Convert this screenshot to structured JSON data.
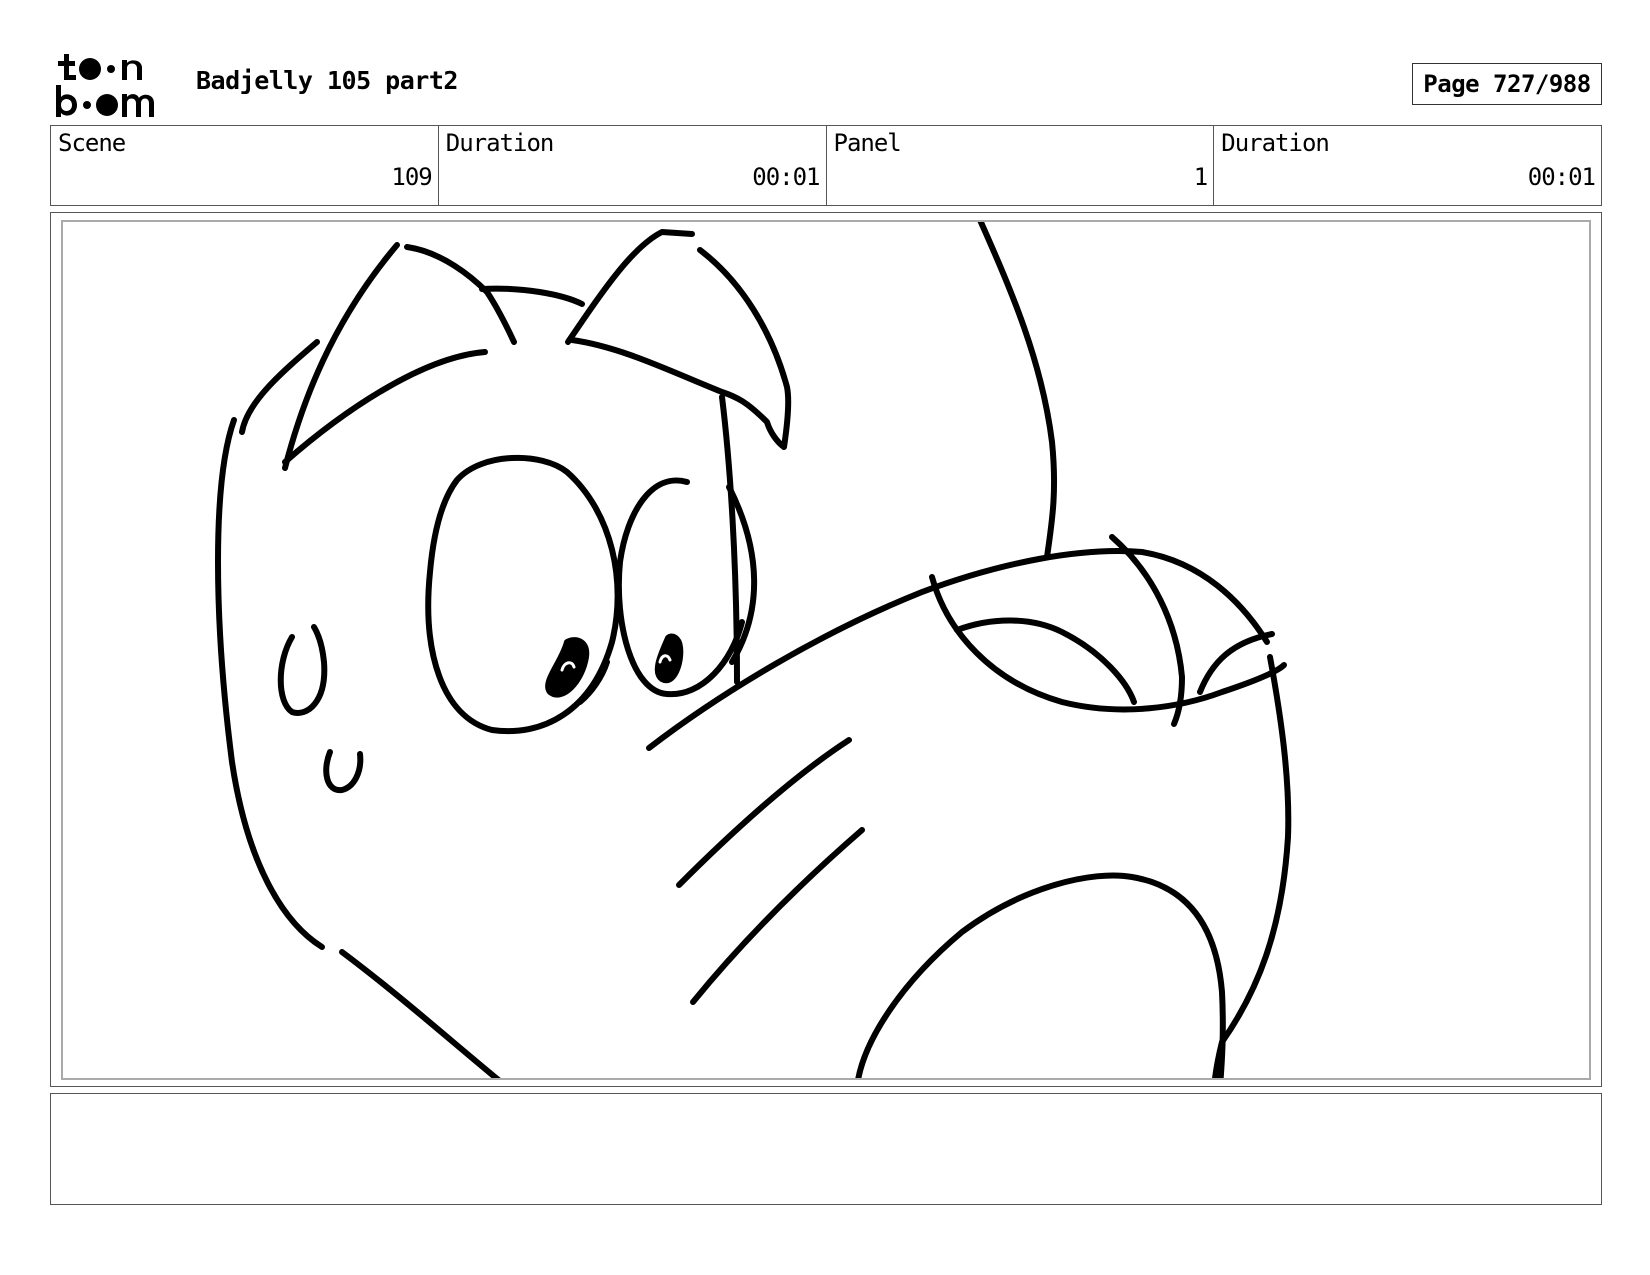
{
  "header": {
    "logo_top": "toon",
    "logo_bottom": "boom",
    "project_title": "Badjelly 105 part2",
    "page_label": "Page 727/988"
  },
  "info": {
    "scene_label": "Scene",
    "scene_value": "109",
    "scene_duration_label": "Duration",
    "scene_duration_value": "00:01",
    "panel_label": "Panel",
    "panel_value": "1",
    "panel_duration_label": "Duration",
    "panel_duration_value": "00:01"
  },
  "notes": {
    "text": ""
  }
}
